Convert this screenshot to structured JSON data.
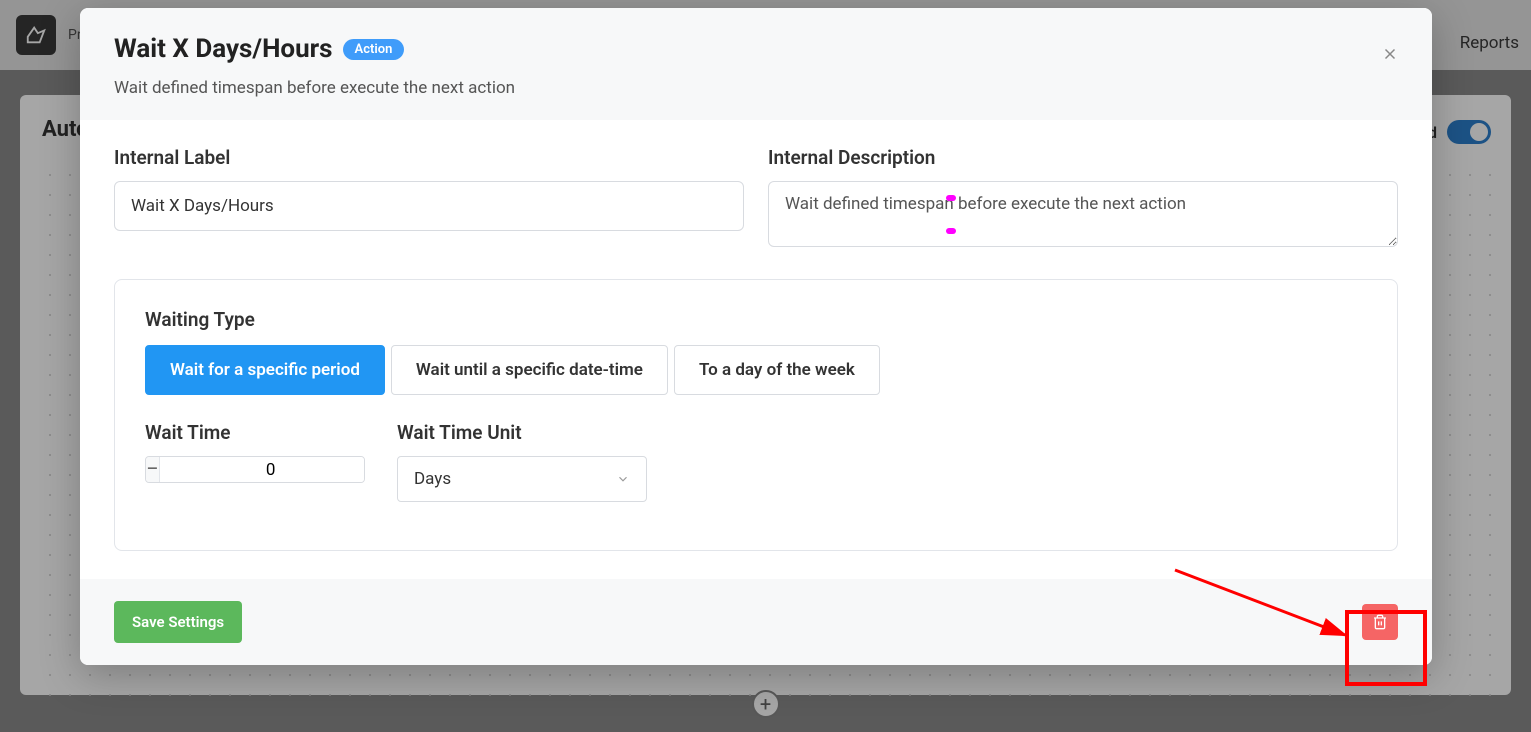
{
  "background": {
    "brand_prefix": "Pr",
    "reports": "Reports",
    "auto_heading": "Auto",
    "toggle_label": "ed"
  },
  "modal": {
    "title": "Wait X Days/Hours",
    "badge": "Action",
    "subtitle": "Wait defined timespan before execute the next action",
    "internal_label": {
      "label": "Internal Label",
      "value": "Wait X Days/Hours"
    },
    "internal_desc": {
      "label": "Internal Description",
      "value": "Wait defined timespan before execute the next action"
    },
    "waiting_type": {
      "label": "Waiting Type",
      "options": [
        "Wait for a specific period",
        "Wait until a specific date-time",
        "To a day of the week"
      ],
      "active_index": 0
    },
    "wait_time": {
      "label": "Wait Time",
      "value": "0"
    },
    "wait_unit": {
      "label": "Wait Time Unit",
      "value": "Days"
    },
    "save_label": "Save Settings"
  },
  "icons": {
    "minus": "−",
    "plus": "+"
  }
}
